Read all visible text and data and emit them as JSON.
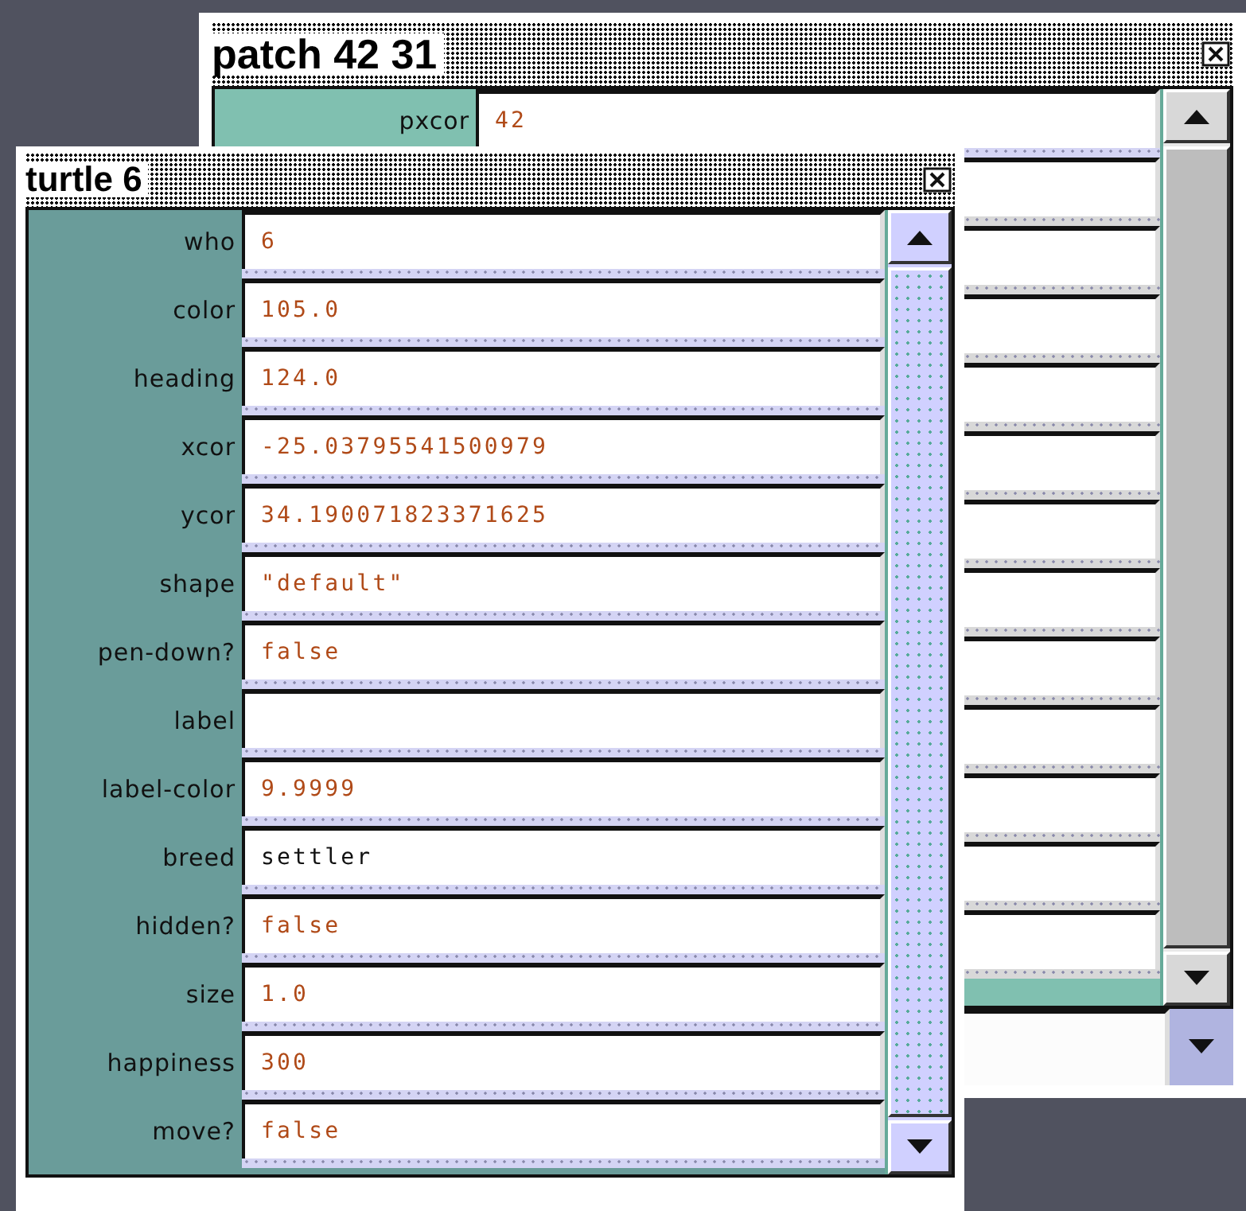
{
  "patch_window": {
    "title": "patch 42 31",
    "rows": [
      {
        "label": "pxcor",
        "value": "42",
        "kind": "number"
      }
    ]
  },
  "turtle_window": {
    "title": "turtle 6",
    "rows": [
      {
        "label": "who",
        "value": "6",
        "kind": "number"
      },
      {
        "label": "color",
        "value": "105.0",
        "kind": "number"
      },
      {
        "label": "heading",
        "value": "124.0",
        "kind": "number"
      },
      {
        "label": "xcor",
        "value": "-25.03795541500979",
        "kind": "number"
      },
      {
        "label": "ycor",
        "value": "34.190071823371625",
        "kind": "number"
      },
      {
        "label": "shape",
        "value": "\"default\"",
        "kind": "number"
      },
      {
        "label": "pen-down?",
        "value": "false",
        "kind": "number"
      },
      {
        "label": "label",
        "kind": "number"
      },
      {
        "label": "label-color",
        "value": "9.9999",
        "kind": "number"
      },
      {
        "label": "breed",
        "value": "settler",
        "kind": "breed"
      },
      {
        "label": "hidden?",
        "value": "false",
        "kind": "number"
      },
      {
        "label": "size",
        "value": "1.0",
        "kind": "number"
      },
      {
        "label": "happiness",
        "value": "300",
        "kind": "number"
      },
      {
        "label": "move?",
        "value": "false",
        "kind": "number"
      }
    ]
  }
}
